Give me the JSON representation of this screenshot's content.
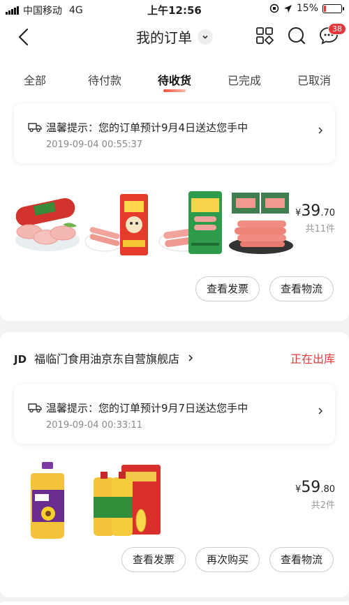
{
  "status_bar": {
    "carrier": "中国移动",
    "network": "4G",
    "time": "上午12:56",
    "battery": "15%",
    "battery_level": 0.15
  },
  "nav": {
    "title": "我的订单",
    "message_badge": "38"
  },
  "tabs": [
    {
      "label": "全部"
    },
    {
      "label": "待付款"
    },
    {
      "label": "待收货",
      "active": true
    },
    {
      "label": "已完成"
    },
    {
      "label": "已取消"
    }
  ],
  "orders": [
    {
      "tip": "温馨提示：您的订单预计9月4日送达您手中",
      "tip_time": "2019-09-04 00:55:37",
      "price_currency": "¥",
      "price_int": "39",
      "price_dec": ".70",
      "quantity": "共11件",
      "products": [
        "sausage-roll",
        "ham-sausage-box",
        "ham-sausage-pack",
        "hot-dog-sausages"
      ],
      "buttons": {
        "invoice": "查看发票",
        "logistics": "查看物流"
      }
    },
    {
      "shop_logo": "JD",
      "shop_name": "福临门食用油京东自营旗舰店",
      "status": "正在出库",
      "tip": "温馨提示：您的订单预计9月7日送达您手中",
      "tip_time": "2019-09-04 00:33:11",
      "price_currency": "¥",
      "price_int": "59",
      "price_dec": ".80",
      "quantity": "共2件",
      "products": [
        "sunflower-oil-bottle",
        "corn-oil-gift-box"
      ],
      "buttons": {
        "invoice": "查看发票",
        "rebuy": "再次购买",
        "logistics": "查看物流"
      }
    }
  ],
  "colors": {
    "accent": "#e4393c",
    "background": "#f2f2f2"
  }
}
